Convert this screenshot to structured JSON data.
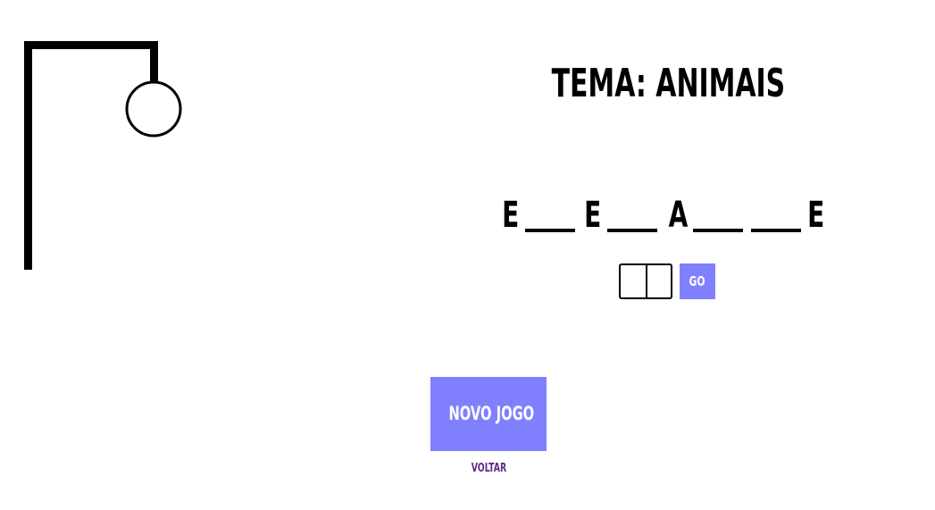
{
  "game": {
    "theme_label": "TEMA: ANIMAIS",
    "word_slots": [
      "E",
      "",
      "E",
      "",
      "A",
      "",
      "",
      "E"
    ],
    "guess_input_value": "",
    "go_label": "GO"
  },
  "actions": {
    "new_game_label": "NOVO JOGO",
    "back_label": "VOLTAR"
  },
  "hangman": {
    "drawn_parts": [
      "gallows",
      "head"
    ]
  },
  "colors": {
    "accent": "#8080ff",
    "link": "#5b2a86",
    "ink": "#000000"
  }
}
